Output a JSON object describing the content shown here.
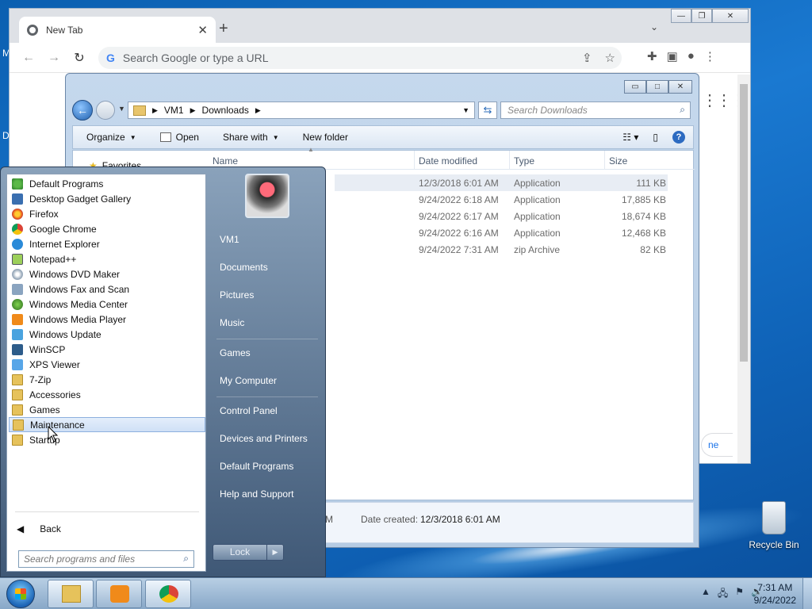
{
  "desktop": {
    "edge_letters": [
      "M",
      "D"
    ],
    "recycle_bin_label": "Recycle Bin"
  },
  "chrome": {
    "tab_title": "New Tab",
    "omnibox_placeholder": "Search Google or type a URL",
    "page_button_fragment": "ne"
  },
  "explorer": {
    "breadcrumb": [
      "VM1",
      "Downloads"
    ],
    "search_placeholder": "Search Downloads",
    "toolbar": {
      "organize": "Organize",
      "open": "Open",
      "share_with": "Share with",
      "new_folder": "New folder"
    },
    "sidebar_favorites": "Favorites",
    "columns": {
      "name": "Name",
      "date_modified": "Date modified",
      "type": "Type",
      "size": "Size"
    },
    "files": [
      {
        "date": "12/3/2018 6:01 AM",
        "type": "Application",
        "size": "111 KB"
      },
      {
        "date": "9/24/2022 6:18 AM",
        "type": "Application",
        "size": "17,885 KB"
      },
      {
        "date": "9/24/2022 6:17 AM",
        "type": "Application",
        "size": "18,674 KB"
      },
      {
        "date": "9/24/2022 6:16 AM",
        "type": "Application",
        "size": "12,468 KB"
      },
      {
        "date": "9/24/2022 7:31 AM",
        "type": "zip Archive",
        "size": "82 KB"
      }
    ],
    "status": {
      "fragment": "M",
      "date_created_label": "Date created:",
      "date_created_value": "12/3/2018 6:01 AM"
    }
  },
  "start_menu": {
    "programs": [
      {
        "label": "Default Programs",
        "icon": "default-programs-icon"
      },
      {
        "label": "Desktop Gadget Gallery",
        "icon": "gadget-icon"
      },
      {
        "label": "Firefox",
        "icon": "firefox-icon"
      },
      {
        "label": "Google Chrome",
        "icon": "chrome-icon"
      },
      {
        "label": "Internet Explorer",
        "icon": "ie-icon"
      },
      {
        "label": "Notepad++",
        "icon": "notepad-icon"
      },
      {
        "label": "Windows DVD Maker",
        "icon": "dvd-icon"
      },
      {
        "label": "Windows Fax and Scan",
        "icon": "fax-icon"
      },
      {
        "label": "Windows Media Center",
        "icon": "media-center-icon"
      },
      {
        "label": "Windows Media Player",
        "icon": "media-player-icon"
      },
      {
        "label": "Windows Update",
        "icon": "update-icon"
      },
      {
        "label": "WinSCP",
        "icon": "winscp-icon"
      },
      {
        "label": "XPS Viewer",
        "icon": "xps-icon"
      },
      {
        "label": "7-Zip",
        "icon": "folder-icon"
      },
      {
        "label": "Accessories",
        "icon": "folder-icon"
      },
      {
        "label": "Games",
        "icon": "folder-icon"
      },
      {
        "label": "Maintenance",
        "icon": "folder-icon"
      },
      {
        "label": "Startup",
        "icon": "folder-icon"
      }
    ],
    "highlighted": "Maintenance",
    "back_label": "Back",
    "search_placeholder": "Search programs and files",
    "right_items": [
      "VM1",
      "Documents",
      "Pictures",
      "Music",
      "Games",
      "My Computer",
      "Control Panel",
      "Devices and Printers",
      "Default Programs",
      "Help and Support"
    ],
    "lock_label": "Lock"
  },
  "taskbar": {
    "time": "7:31 AM",
    "date": "9/24/2022"
  }
}
